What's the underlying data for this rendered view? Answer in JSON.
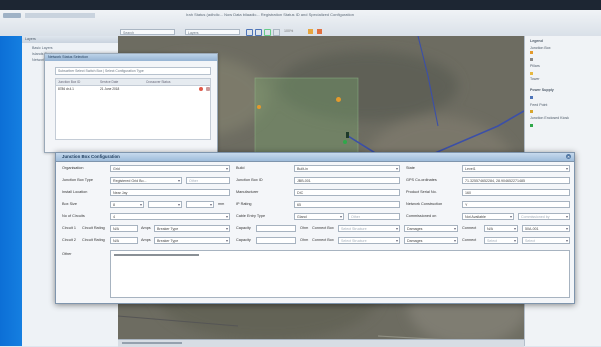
{
  "app": {
    "title": "Irah Status (adhdic... Now Data bilaadic... Registration Status ID and Specialized Configuration"
  },
  "toolbar": {
    "search_text": "Search",
    "layer_select": "Layers",
    "zoom_text": "100%"
  },
  "layers_panel": {
    "header": "Layers",
    "items": [
      "Basic Layers",
      "Islands Seats",
      "Network Status"
    ]
  },
  "subpanel": {
    "title": "Network Status Selection",
    "tab_text": "Subscriber Select Switch Box | Select Configuration Type",
    "columns": [
      "Junction Box ID",
      "Service Date",
      "Crossover Status"
    ],
    "row": [
      "8786 dr.4.1",
      "21 June 2018",
      ""
    ]
  },
  "legend": {
    "title": "Legend",
    "items": [
      {
        "label": "Junction Box",
        "color": "#e49a2c"
      },
      {
        "label": "Pillars",
        "color": "#888888"
      },
      {
        "label": "Tower",
        "color": "#e6b840"
      },
      {
        "label": "Power Supply",
        "color": "#4d74b8"
      },
      {
        "label": "Feed Point",
        "color": "#d7a52c"
      },
      {
        "label": "Junction Enclosed Kiosk",
        "color": "#2fa84a"
      }
    ]
  },
  "dialog": {
    "title": "Junction Box Configuration",
    "rows": [
      [
        {
          "label": "Organisation",
          "value": "Grid",
          "type": "select"
        },
        {
          "label": "Build",
          "value": "Built-in",
          "type": "select"
        },
        {
          "label": "State",
          "value": "Level1",
          "type": "select"
        }
      ],
      [
        {
          "label": "Junction Box Type",
          "value": "Registered Grid Bo...",
          "type": "select",
          "extra": "Other"
        },
        {
          "label": "Junction Box ID",
          "value": "JBB-001",
          "type": "text"
        },
        {
          "label": "GPS Co-ordinates",
          "value": "71.325574652284, 28.904652271485",
          "type": "text"
        }
      ],
      [
        {
          "label": "Install Location",
          "value": "Near Jay",
          "type": "text"
        },
        {
          "label": "Manufacturer",
          "value": "DIC",
          "type": "text"
        },
        {
          "label": "Product Serial No.",
          "value": "160",
          "type": "text"
        }
      ],
      [
        {
          "label": "Box Size",
          "value": "8",
          "type": "select",
          "extra": "mm"
        },
        {
          "label": "IP Rating",
          "value": "65",
          "type": "text"
        },
        {
          "label": "Network Construction",
          "value": "Y",
          "type": "text"
        }
      ],
      [
        {
          "label": "No of Circuits",
          "value": "4",
          "type": "select"
        },
        {
          "label": "Cable Entry Type",
          "value": "Gland",
          "type": "select",
          "extra": "Other"
        },
        {
          "label": "Commissioned on",
          "value": "Not Available",
          "type": "select",
          "extra": "Commissioned by"
        }
      ]
    ],
    "circuit_rows": [
      [
        "Circuit 1",
        "Circuit Rating",
        "N/A",
        "Amps",
        "Breaker Type",
        "Capacity",
        "Ohm",
        "Connect Box",
        "Select Structure",
        "Damages",
        "Connect",
        "N/A",
        "50A-001"
      ],
      [
        "Circuit 2",
        "Circuit Rating",
        "N/A",
        "Amps",
        "Breaker Type",
        "Capacity",
        "Ohm",
        "Connect Box",
        "Select Structure",
        "Damages",
        "Connect",
        "Select",
        "Select"
      ]
    ],
    "other_label": "Other"
  }
}
